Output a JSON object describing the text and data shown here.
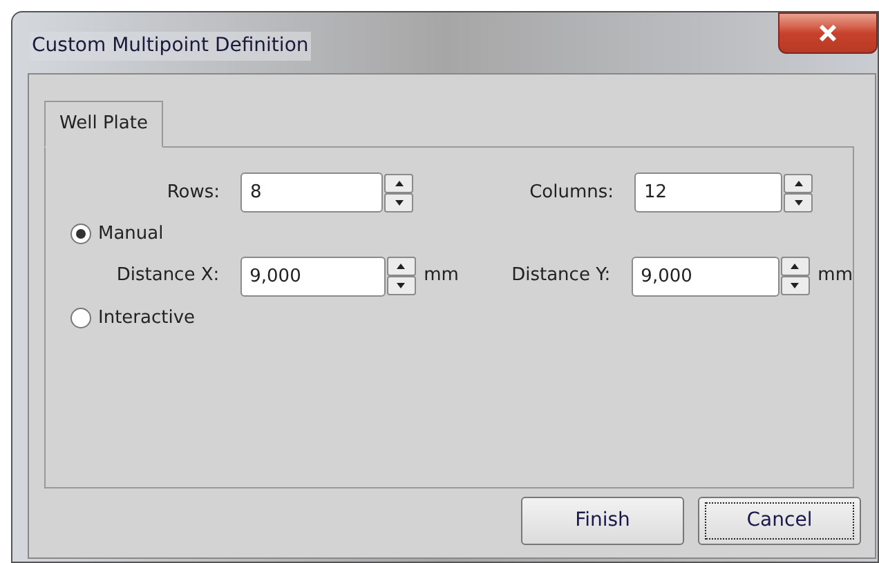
{
  "window": {
    "title": "Custom Multipoint Definition"
  },
  "tabs": [
    {
      "label": "Well Plate",
      "selected": true
    }
  ],
  "grid": {
    "rows": {
      "label": "Rows:",
      "value": "8"
    },
    "columns": {
      "label": "Columns:",
      "value": "12"
    }
  },
  "modes": [
    {
      "label": "Manual",
      "selected": true
    },
    {
      "label": "Interactive",
      "selected": false
    }
  ],
  "distance": {
    "x": {
      "label": "Distance X:",
      "value": "9,000",
      "unit": "mm"
    },
    "y": {
      "label": "Distance Y:",
      "value": "9,000",
      "unit": "mm"
    }
  },
  "buttons": [
    {
      "label": "Finish",
      "focused": false
    },
    {
      "label": "Cancel",
      "focused": true
    }
  ]
}
